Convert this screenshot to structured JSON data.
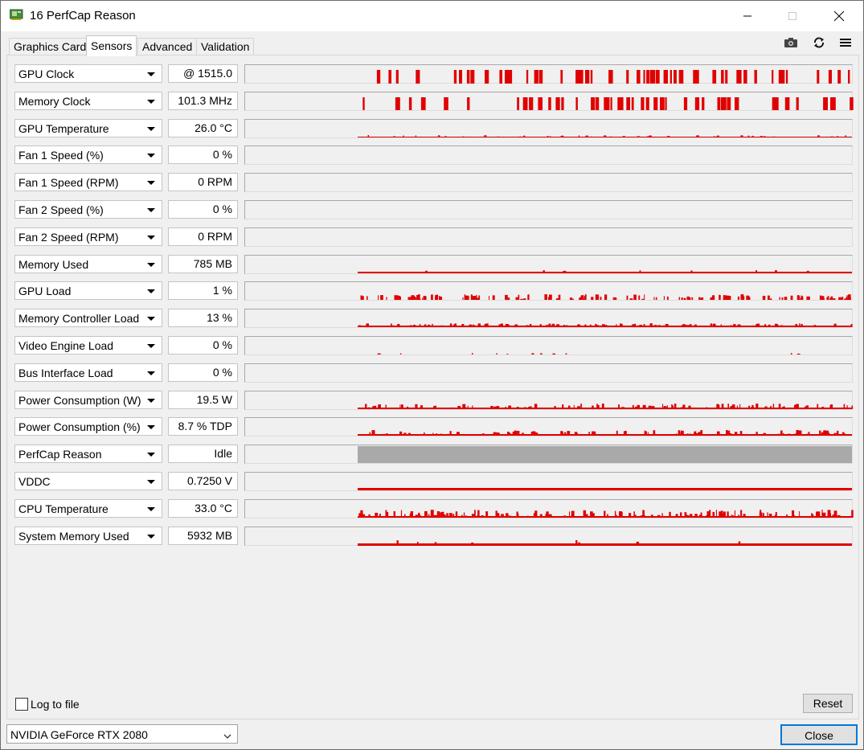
{
  "window": {
    "title": "16  PerfCap Reason"
  },
  "tabs": [
    {
      "label": "Graphics Card",
      "active": false
    },
    {
      "label": "Sensors",
      "active": true
    },
    {
      "label": "Advanced",
      "active": false
    },
    {
      "label": "Validation",
      "active": false
    }
  ],
  "toolbar": {
    "icons": [
      "camera-icon",
      "refresh-icon",
      "menu-icon"
    ]
  },
  "sensors": [
    {
      "name": "GPU Clock",
      "value": "@ 1515.0"
    },
    {
      "name": "Memory Clock",
      "value": "101.3 MHz"
    },
    {
      "name": "GPU Temperature",
      "value": "26.0 °C"
    },
    {
      "name": "Fan 1 Speed (%)",
      "value": "0 %"
    },
    {
      "name": "Fan 1 Speed (RPM)",
      "value": "0 RPM"
    },
    {
      "name": "Fan 2 Speed (%)",
      "value": "0 %"
    },
    {
      "name": "Fan 2 Speed (RPM)",
      "value": "0 RPM"
    },
    {
      "name": "Memory Used",
      "value": "785 MB"
    },
    {
      "name": "GPU Load",
      "value": "1 %"
    },
    {
      "name": "Memory Controller Load",
      "value": "13 %"
    },
    {
      "name": "Video Engine Load",
      "value": "0 %"
    },
    {
      "name": "Bus Interface Load",
      "value": "0 %"
    },
    {
      "name": "Power Consumption (W)",
      "value": "19.5 W"
    },
    {
      "name": "Power Consumption (%)",
      "value": "8.7 % TDP"
    },
    {
      "name": "PerfCap Reason",
      "value": "Idle"
    },
    {
      "name": "VDDC",
      "value": "0.7250 V"
    },
    {
      "name": "CPU Temperature",
      "value": "33.0 °C"
    },
    {
      "name": "System Memory Used",
      "value": "5932 MB"
    }
  ],
  "footer": {
    "log_label": "Log to file",
    "log_checked": false,
    "reset_label": "Reset",
    "gpu_selected": "NVIDIA GeForce RTX 2080",
    "close_label": "Close"
  },
  "colors": {
    "graph_line": "#e00000",
    "perfcap_idle": "#a9a9a9"
  }
}
